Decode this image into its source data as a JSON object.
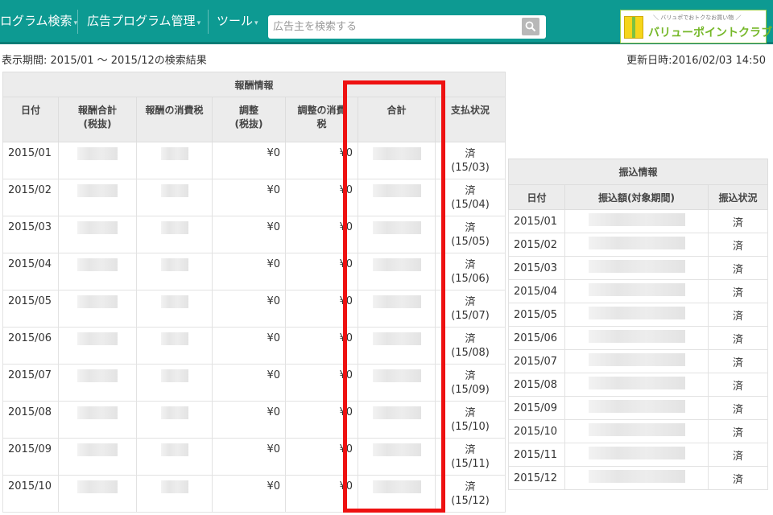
{
  "nav": {
    "items": [
      {
        "label": "ログラム検索",
        "has_caret": true
      },
      {
        "label": "広告プログラム管理",
        "has_caret": true
      },
      {
        "label": "ツール",
        "has_caret": true
      }
    ],
    "caret": "▾",
    "search_placeholder": "広告主を検索する",
    "search_icon": "search-icon",
    "logo": {
      "tagline": "＼ バリュポでおトクなお買い物 ／",
      "name": "バリューポイントクラブ"
    }
  },
  "info": {
    "period": "表示期間: 2015/01 〜 2015/12の検索結果",
    "updated": "更新日時:2016/02/03 14:50"
  },
  "reward_table": {
    "group_header": "報酬情報",
    "columns": [
      "日付",
      "報酬合計\n(税抜)",
      "報酬の消費税",
      "調整\n(税抜)",
      "調整の消費\n税",
      "合計",
      "支払状況"
    ],
    "rows": [
      {
        "date": "2015/01",
        "adjust": "¥0",
        "adjust_tax": "¥0",
        "status": "済",
        "paid": "(15/03)"
      },
      {
        "date": "2015/02",
        "adjust": "¥0",
        "adjust_tax": "¥0",
        "status": "済",
        "paid": "(15/04)"
      },
      {
        "date": "2015/03",
        "adjust": "¥0",
        "adjust_tax": "¥0",
        "status": "済",
        "paid": "(15/05)"
      },
      {
        "date": "2015/04",
        "adjust": "¥0",
        "adjust_tax": "¥0",
        "status": "済",
        "paid": "(15/06)"
      },
      {
        "date": "2015/05",
        "adjust": "¥0",
        "adjust_tax": "¥0",
        "status": "済",
        "paid": "(15/07)"
      },
      {
        "date": "2015/06",
        "adjust": "¥0",
        "adjust_tax": "¥0",
        "status": "済",
        "paid": "(15/08)"
      },
      {
        "date": "2015/07",
        "adjust": "¥0",
        "adjust_tax": "¥0",
        "status": "済",
        "paid": "(15/09)"
      },
      {
        "date": "2015/08",
        "adjust": "¥0",
        "adjust_tax": "¥0",
        "status": "済",
        "paid": "(15/10)"
      },
      {
        "date": "2015/09",
        "adjust": "¥0",
        "adjust_tax": "¥0",
        "status": "済",
        "paid": "(15/11)"
      },
      {
        "date": "2015/10",
        "adjust": "¥0",
        "adjust_tax": "¥0",
        "status": "済",
        "paid": "(15/12)"
      }
    ]
  },
  "transfer_table": {
    "group_header": "振込情報",
    "columns": [
      "日付",
      "振込額(対象期間)",
      "振込状況"
    ],
    "rows": [
      {
        "date": "2015/01",
        "status": "済"
      },
      {
        "date": "2015/02",
        "status": "済"
      },
      {
        "date": "2015/03",
        "status": "済"
      },
      {
        "date": "2015/04",
        "status": "済"
      },
      {
        "date": "2015/05",
        "status": "済"
      },
      {
        "date": "2015/06",
        "status": "済"
      },
      {
        "date": "2015/07",
        "status": "済"
      },
      {
        "date": "2015/08",
        "status": "済"
      },
      {
        "date": "2015/09",
        "status": "済"
      },
      {
        "date": "2015/10",
        "status": "済"
      },
      {
        "date": "2015/11",
        "status": "済"
      },
      {
        "date": "2015/12",
        "status": "済"
      }
    ]
  },
  "highlight_color": "#ee1111"
}
